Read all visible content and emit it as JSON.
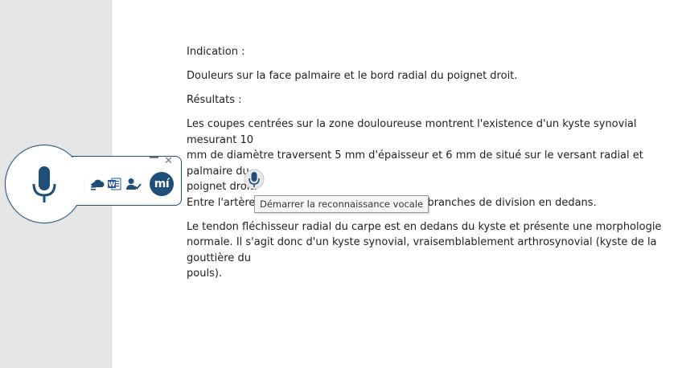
{
  "document": {
    "indication_label": "Indication :",
    "indication_text": "Douleurs sur la face palmaire et le bord radial du poignet droit.",
    "results_label": "Résultats :",
    "results_line1": "Les coupes centrées sur la zone douloureuse montrent l'existence d'un kyste synovial mesurant 10",
    "results_line2": "mm de diamètre traversent 5 mm d'épaisseur et 6 mm de situé sur le versant radial et palmaire du",
    "results_line3": "poignet droit.",
    "results_line4": "Entre l'artère radiale en dehors et une de ses branches de division en dedans.",
    "tendon_line1": "Le tendon fléchisseur radial du carpe est en dedans du kyste et présente une morphologie",
    "tendon_line2": "normale. Il s'agit donc d'un kyste synovial, vraisemblablement arthrosynovial (kyste de la gouttière du",
    "tendon_line3": "pouls)."
  },
  "widget": {
    "minimize_label": "—",
    "close_label": "✕",
    "logo_text": "mí",
    "icons": [
      "microphone-icon",
      "cloud-upload-icon",
      "word-icon",
      "user-check-icon"
    ],
    "accent_color": "#1f4e79"
  },
  "tooltip": {
    "text": "Démarrer la reconnaissance vocale"
  }
}
